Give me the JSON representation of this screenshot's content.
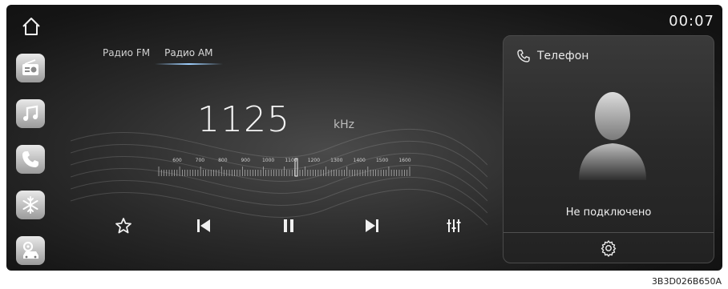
{
  "clock": {
    "time": "00:07"
  },
  "sidebar": {
    "items": [
      {
        "name": "radio"
      },
      {
        "name": "music"
      },
      {
        "name": "phone"
      },
      {
        "name": "climate"
      },
      {
        "name": "vehicle-settings"
      }
    ]
  },
  "radio": {
    "tabs": [
      {
        "label": "Радио FM",
        "active": false
      },
      {
        "label": "Радио AM",
        "active": true
      }
    ],
    "frequency": "1125",
    "unit": "kHz",
    "scale_labels": [
      "600",
      "700",
      "800",
      "900",
      "1000",
      "1100",
      "1200",
      "1300",
      "1400",
      "1500",
      "1600"
    ]
  },
  "phone": {
    "title": "Телефон",
    "status": "Не подключено"
  },
  "figure_code": "3B3D026B650A"
}
